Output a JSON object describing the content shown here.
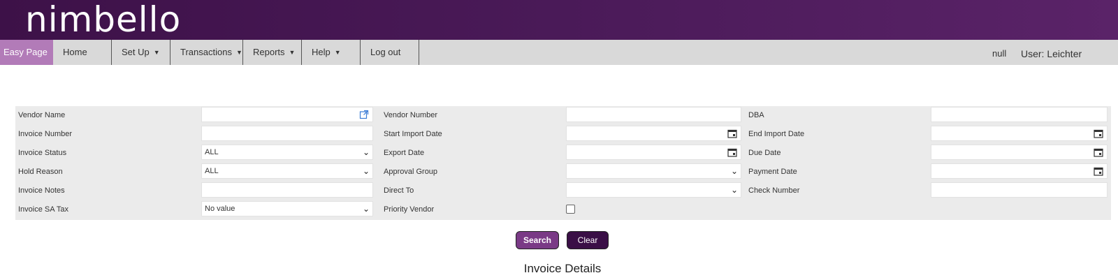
{
  "brand": {
    "logo_text": "nimbello"
  },
  "nav": {
    "easy_page": "Easy Page",
    "home": "Home",
    "setup": "Set Up",
    "transactions": "Transactions",
    "reports": "Reports",
    "help": "Help",
    "logout": "Log out",
    "null_text": "null",
    "user": "User: Leichter"
  },
  "filters": {
    "vendor_name": {
      "label": "Vendor Name",
      "value": ""
    },
    "vendor_number": {
      "label": "Vendor Number",
      "value": ""
    },
    "dba": {
      "label": "DBA",
      "value": ""
    },
    "invoice_number": {
      "label": "Invoice Number",
      "value": ""
    },
    "start_import_date": {
      "label": "Start Import Date",
      "value": ""
    },
    "end_import_date": {
      "label": "End Import Date",
      "value": ""
    },
    "invoice_status": {
      "label": "Invoice Status",
      "value": "ALL"
    },
    "export_date": {
      "label": "Export Date",
      "value": ""
    },
    "due_date": {
      "label": "Due Date",
      "value": ""
    },
    "hold_reason": {
      "label": "Hold Reason",
      "value": "ALL"
    },
    "approval_group": {
      "label": "Approval Group",
      "value": ""
    },
    "payment_date": {
      "label": "Payment Date",
      "value": ""
    },
    "invoice_notes": {
      "label": "Invoice Notes",
      "value": ""
    },
    "direct_to": {
      "label": "Direct To",
      "value": ""
    },
    "check_number": {
      "label": "Check Number",
      "value": ""
    },
    "invoice_sa_tax": {
      "label": "Invoice SA Tax",
      "value": "No value"
    },
    "priority_vendor": {
      "label": "Priority Vendor",
      "checked": false
    }
  },
  "actions": {
    "search": "Search",
    "clear": "Clear"
  },
  "section": {
    "title": "Invoice Details"
  },
  "colors": {
    "banner": "#4a1a58",
    "easy_page": "#b27bb8",
    "search_btn": "#7a3a86",
    "clear_btn": "#3a0f46"
  }
}
